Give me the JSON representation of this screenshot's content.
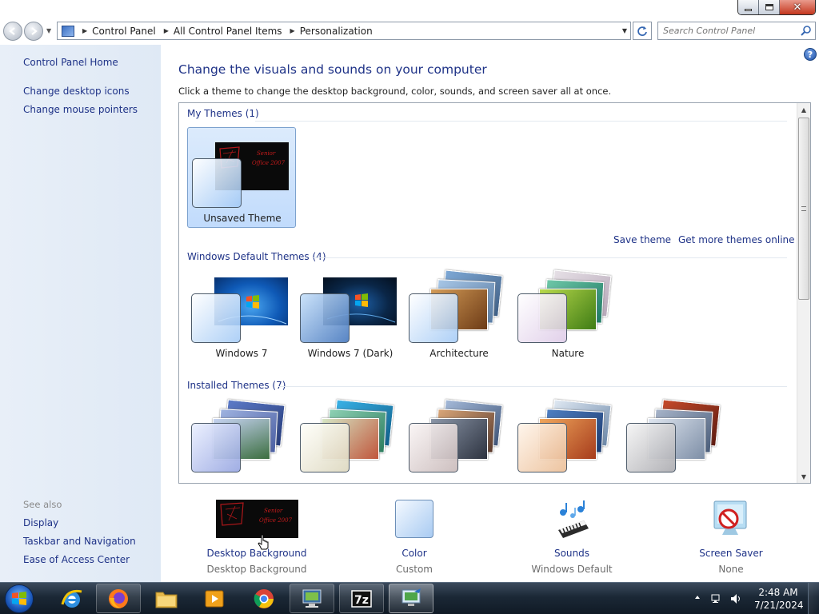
{
  "window": {
    "controls": {
      "minimize": "",
      "maximize": "",
      "close": "✕"
    }
  },
  "address_bar": {
    "crumbs": [
      "Control Panel",
      "All Control Panel Items",
      "Personalization"
    ],
    "search_placeholder": "Search Control Panel"
  },
  "sidebar": {
    "links": [
      {
        "label": "Control Panel Home"
      },
      {
        "label": "Change desktop icons"
      },
      {
        "label": "Change mouse pointers"
      }
    ],
    "see_also_title": "See also",
    "see_also": [
      {
        "label": "Display"
      },
      {
        "label": "Taskbar and Navigation"
      },
      {
        "label": "Ease of Access Center"
      }
    ]
  },
  "main": {
    "heading": "Change the visuals and sounds on your computer",
    "subheading": "Click a theme to change the desktop background, color, sounds, and screen saver all at once.",
    "groups": {
      "my_themes": {
        "label": "My Themes (1)",
        "themes": [
          {
            "name": "Unsaved Theme",
            "thumb_text": "Senior Office 2007"
          }
        ]
      },
      "actions": {
        "save": "Save theme",
        "more": "Get more themes online"
      },
      "default_themes": {
        "label": "Windows Default Themes (4)",
        "themes": [
          {
            "name": "Windows 7"
          },
          {
            "name": "Windows 7 (Dark)"
          },
          {
            "name": "Architecture"
          },
          {
            "name": "Nature"
          }
        ]
      },
      "installed_themes": {
        "label": "Installed Themes (7)"
      }
    },
    "bottom": [
      {
        "label": "Desktop Background",
        "value": "Desktop Background",
        "thumb_text": "Senior Office 2007"
      },
      {
        "label": "Color",
        "value": "Custom"
      },
      {
        "label": "Sounds",
        "value": "Windows Default"
      },
      {
        "label": "Screen Saver",
        "value": "None"
      }
    ]
  },
  "taskbar": {
    "apps": [
      "Internet Explorer",
      "Firefox",
      "File Explorer",
      "Media Player",
      "Chrome",
      "Remote Desktop",
      "7-Zip",
      "Control Panel"
    ],
    "clock_time": "2:48 AM",
    "clock_date": "7/21/2024"
  },
  "colors": {
    "link_blue": "#1e3287",
    "sidebar_bg": "#e2ebf6",
    "selected_theme_bg": "#c9e0fc"
  }
}
